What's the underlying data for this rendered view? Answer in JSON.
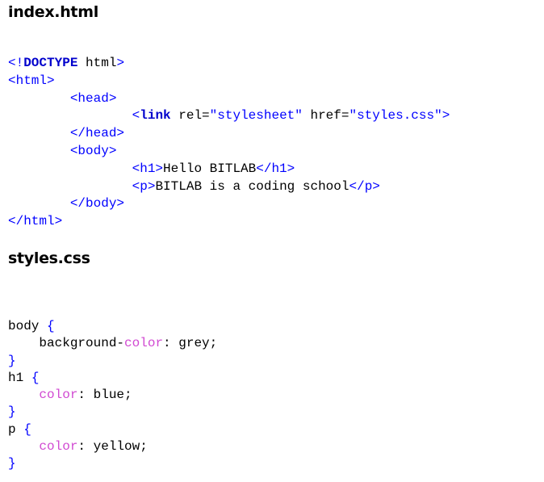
{
  "headings": {
    "html_file": "index.html",
    "css_file": "styles.css"
  },
  "html_code": {
    "l1": {
      "open": "<!",
      "kw": "DOCTYPE",
      "text": " html",
      "close": ">"
    },
    "l2": {
      "tag": "<html>"
    },
    "l3": {
      "indent": "        ",
      "tag": "<head>"
    },
    "l4": {
      "indent": "                ",
      "lt": "<",
      "kw": "link",
      "attr1": " rel=",
      "val1": "\"stylesheet\"",
      "attr2": " href=",
      "val2": "\"styles.css\"",
      "gt": ">"
    },
    "l5": {
      "indent": "        ",
      "tag": "</head>"
    },
    "l6": {
      "indent": "        ",
      "tag": "<body>"
    },
    "l7": {
      "indent": "                ",
      "open": "<h1>",
      "text": "Hello BITLAB",
      "close": "</h1>"
    },
    "l8": {
      "indent": "                ",
      "open": "<p>",
      "text": "BITLAB is a coding school",
      "close": "</p>"
    },
    "l9": {
      "indent": "        ",
      "tag": "</body>"
    },
    "l10": {
      "tag": "</html>"
    }
  },
  "css_code": {
    "r1": {
      "selector": "body ",
      "brace": "{"
    },
    "r2": {
      "indent": "    ",
      "pre": "background-",
      "prop": "color",
      "value": ": grey;"
    },
    "r3": {
      "brace": "}"
    },
    "r4": {
      "selector": "h1 ",
      "brace": "{"
    },
    "r5": {
      "indent": "    ",
      "prop": "color",
      "value": ": blue;"
    },
    "r6": {
      "brace": "}"
    },
    "r7": {
      "selector": "p ",
      "brace": "{"
    },
    "r8": {
      "indent": "    ",
      "prop": "color",
      "value": ": yellow;"
    },
    "r9": {
      "brace": "}"
    }
  }
}
